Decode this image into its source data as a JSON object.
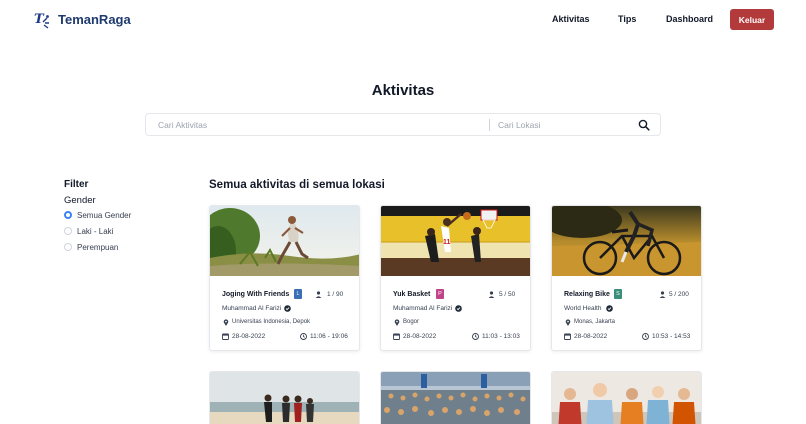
{
  "brand": {
    "name": "TemanRaga",
    "mark": "T",
    "accent": "#1e3a6e"
  },
  "nav": {
    "links": [
      "Aktivitas",
      "Tips",
      "Dashboard"
    ],
    "logout_label": "Keluar",
    "logout_color": "#b33a3a"
  },
  "page": {
    "title": "Aktivitas"
  },
  "search": {
    "activity_placeholder": "Cari Aktivitas",
    "location_placeholder": "Cari Lokasi",
    "icon": "search-icon"
  },
  "filter": {
    "title": "Filter",
    "group_label": "Gender",
    "options": [
      {
        "label": "Semua Gender",
        "checked": true
      },
      {
        "label": "Laki - Laki",
        "checked": false
      },
      {
        "label": "Perempuan",
        "checked": false
      }
    ]
  },
  "section": {
    "title": "Semua aktivitas di semua lokasi"
  },
  "cards": [
    {
      "title": "Joging With Friends",
      "badge": "L",
      "badge_color": "#3b6fb6",
      "capacity": "1 / 90",
      "organizer": "Muhammad Al Farizi",
      "verified": true,
      "location": "Universitas Indonesia, Depok",
      "date": "28-08-2022",
      "time": "11:06 - 19:06",
      "image": "runner-on-trail"
    },
    {
      "title": "Yuk Basket",
      "badge": "P",
      "badge_color": "#c0448a",
      "capacity": "5 / 50",
      "organizer": "Muhammad Al Farizi",
      "verified": true,
      "location": "Bogor",
      "date": "28-08-2022",
      "time": "11:03 - 13:03",
      "image": "basketball-game"
    },
    {
      "title": "Relaxing Bike",
      "badge": "S",
      "badge_color": "#3a8f7a",
      "capacity": "5 / 200",
      "organizer": "World Health",
      "verified": true,
      "location": "Monas, Jakarta",
      "date": "28-08-2022",
      "time": "10:53 - 14:53",
      "image": "cyclist-sunset"
    }
  ],
  "more_cards": [
    {
      "image": "group-running-beach"
    },
    {
      "image": "marathon-crowd"
    },
    {
      "image": "children-group"
    }
  ]
}
